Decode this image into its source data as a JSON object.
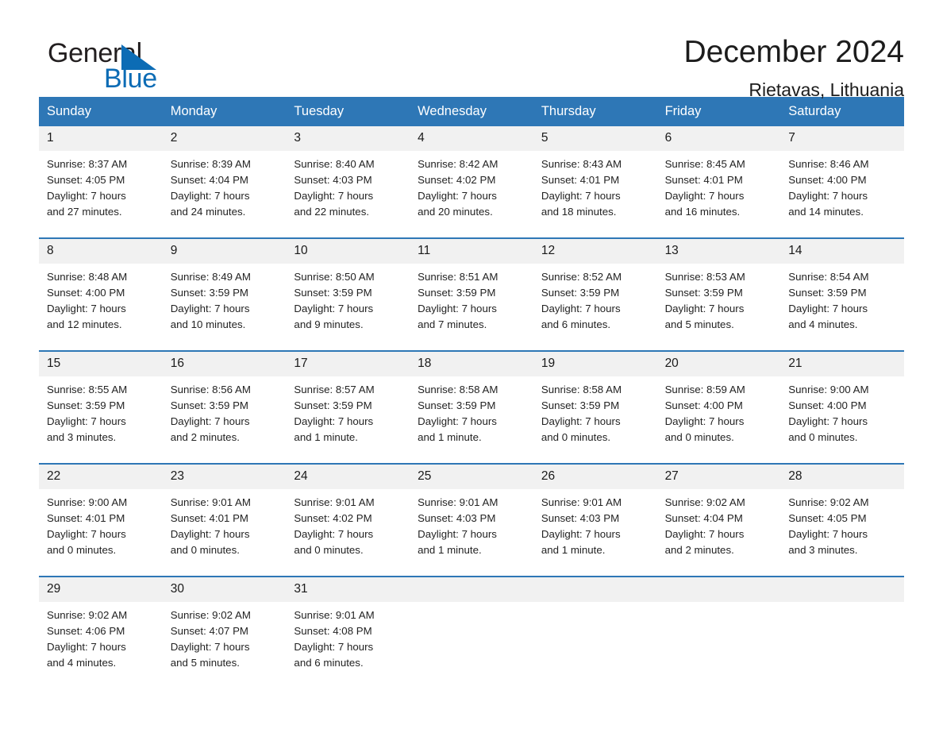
{
  "brand": {
    "name_part1": "General",
    "name_part2": "Blue",
    "mark": "triangle-logo",
    "accent_color": "#0c6cb5"
  },
  "header": {
    "title": "December 2024",
    "subtitle": "Rietavas, Lithuania"
  },
  "theme": {
    "header_bg": "#2e77b6",
    "header_text": "#ffffff",
    "daynum_bg": "#f1f1f1",
    "rule_color": "#2e77b6",
    "body_text": "#232323"
  },
  "weekdays": [
    "Sunday",
    "Monday",
    "Tuesday",
    "Wednesday",
    "Thursday",
    "Friday",
    "Saturday"
  ],
  "labels": {
    "sunrise_prefix": "Sunrise:",
    "sunset_prefix": "Sunset:",
    "daylight_prefix": "Daylight:"
  },
  "weeks": [
    [
      {
        "day": "1",
        "sunrise": "Sunrise: 8:37 AM",
        "sunset": "Sunset: 4:05 PM",
        "daylight_line1": "Daylight: 7 hours",
        "daylight_line2": "and 27 minutes."
      },
      {
        "day": "2",
        "sunrise": "Sunrise: 8:39 AM",
        "sunset": "Sunset: 4:04 PM",
        "daylight_line1": "Daylight: 7 hours",
        "daylight_line2": "and 24 minutes."
      },
      {
        "day": "3",
        "sunrise": "Sunrise: 8:40 AM",
        "sunset": "Sunset: 4:03 PM",
        "daylight_line1": "Daylight: 7 hours",
        "daylight_line2": "and 22 minutes."
      },
      {
        "day": "4",
        "sunrise": "Sunrise: 8:42 AM",
        "sunset": "Sunset: 4:02 PM",
        "daylight_line1": "Daylight: 7 hours",
        "daylight_line2": "and 20 minutes."
      },
      {
        "day": "5",
        "sunrise": "Sunrise: 8:43 AM",
        "sunset": "Sunset: 4:01 PM",
        "daylight_line1": "Daylight: 7 hours",
        "daylight_line2": "and 18 minutes."
      },
      {
        "day": "6",
        "sunrise": "Sunrise: 8:45 AM",
        "sunset": "Sunset: 4:01 PM",
        "daylight_line1": "Daylight: 7 hours",
        "daylight_line2": "and 16 minutes."
      },
      {
        "day": "7",
        "sunrise": "Sunrise: 8:46 AM",
        "sunset": "Sunset: 4:00 PM",
        "daylight_line1": "Daylight: 7 hours",
        "daylight_line2": "and 14 minutes."
      }
    ],
    [
      {
        "day": "8",
        "sunrise": "Sunrise: 8:48 AM",
        "sunset": "Sunset: 4:00 PM",
        "daylight_line1": "Daylight: 7 hours",
        "daylight_line2": "and 12 minutes."
      },
      {
        "day": "9",
        "sunrise": "Sunrise: 8:49 AM",
        "sunset": "Sunset: 3:59 PM",
        "daylight_line1": "Daylight: 7 hours",
        "daylight_line2": "and 10 minutes."
      },
      {
        "day": "10",
        "sunrise": "Sunrise: 8:50 AM",
        "sunset": "Sunset: 3:59 PM",
        "daylight_line1": "Daylight: 7 hours",
        "daylight_line2": "and 9 minutes."
      },
      {
        "day": "11",
        "sunrise": "Sunrise: 8:51 AM",
        "sunset": "Sunset: 3:59 PM",
        "daylight_line1": "Daylight: 7 hours",
        "daylight_line2": "and 7 minutes."
      },
      {
        "day": "12",
        "sunrise": "Sunrise: 8:52 AM",
        "sunset": "Sunset: 3:59 PM",
        "daylight_line1": "Daylight: 7 hours",
        "daylight_line2": "and 6 minutes."
      },
      {
        "day": "13",
        "sunrise": "Sunrise: 8:53 AM",
        "sunset": "Sunset: 3:59 PM",
        "daylight_line1": "Daylight: 7 hours",
        "daylight_line2": "and 5 minutes."
      },
      {
        "day": "14",
        "sunrise": "Sunrise: 8:54 AM",
        "sunset": "Sunset: 3:59 PM",
        "daylight_line1": "Daylight: 7 hours",
        "daylight_line2": "and 4 minutes."
      }
    ],
    [
      {
        "day": "15",
        "sunrise": "Sunrise: 8:55 AM",
        "sunset": "Sunset: 3:59 PM",
        "daylight_line1": "Daylight: 7 hours",
        "daylight_line2": "and 3 minutes."
      },
      {
        "day": "16",
        "sunrise": "Sunrise: 8:56 AM",
        "sunset": "Sunset: 3:59 PM",
        "daylight_line1": "Daylight: 7 hours",
        "daylight_line2": "and 2 minutes."
      },
      {
        "day": "17",
        "sunrise": "Sunrise: 8:57 AM",
        "sunset": "Sunset: 3:59 PM",
        "daylight_line1": "Daylight: 7 hours",
        "daylight_line2": "and 1 minute."
      },
      {
        "day": "18",
        "sunrise": "Sunrise: 8:58 AM",
        "sunset": "Sunset: 3:59 PM",
        "daylight_line1": "Daylight: 7 hours",
        "daylight_line2": "and 1 minute."
      },
      {
        "day": "19",
        "sunrise": "Sunrise: 8:58 AM",
        "sunset": "Sunset: 3:59 PM",
        "daylight_line1": "Daylight: 7 hours",
        "daylight_line2": "and 0 minutes."
      },
      {
        "day": "20",
        "sunrise": "Sunrise: 8:59 AM",
        "sunset": "Sunset: 4:00 PM",
        "daylight_line1": "Daylight: 7 hours",
        "daylight_line2": "and 0 minutes."
      },
      {
        "day": "21",
        "sunrise": "Sunrise: 9:00 AM",
        "sunset": "Sunset: 4:00 PM",
        "daylight_line1": "Daylight: 7 hours",
        "daylight_line2": "and 0 minutes."
      }
    ],
    [
      {
        "day": "22",
        "sunrise": "Sunrise: 9:00 AM",
        "sunset": "Sunset: 4:01 PM",
        "daylight_line1": "Daylight: 7 hours",
        "daylight_line2": "and 0 minutes."
      },
      {
        "day": "23",
        "sunrise": "Sunrise: 9:01 AM",
        "sunset": "Sunset: 4:01 PM",
        "daylight_line1": "Daylight: 7 hours",
        "daylight_line2": "and 0 minutes."
      },
      {
        "day": "24",
        "sunrise": "Sunrise: 9:01 AM",
        "sunset": "Sunset: 4:02 PM",
        "daylight_line1": "Daylight: 7 hours",
        "daylight_line2": "and 0 minutes."
      },
      {
        "day": "25",
        "sunrise": "Sunrise: 9:01 AM",
        "sunset": "Sunset: 4:03 PM",
        "daylight_line1": "Daylight: 7 hours",
        "daylight_line2": "and 1 minute."
      },
      {
        "day": "26",
        "sunrise": "Sunrise: 9:01 AM",
        "sunset": "Sunset: 4:03 PM",
        "daylight_line1": "Daylight: 7 hours",
        "daylight_line2": "and 1 minute."
      },
      {
        "day": "27",
        "sunrise": "Sunrise: 9:02 AM",
        "sunset": "Sunset: 4:04 PM",
        "daylight_line1": "Daylight: 7 hours",
        "daylight_line2": "and 2 minutes."
      },
      {
        "day": "28",
        "sunrise": "Sunrise: 9:02 AM",
        "sunset": "Sunset: 4:05 PM",
        "daylight_line1": "Daylight: 7 hours",
        "daylight_line2": "and 3 minutes."
      }
    ],
    [
      {
        "day": "29",
        "sunrise": "Sunrise: 9:02 AM",
        "sunset": "Sunset: 4:06 PM",
        "daylight_line1": "Daylight: 7 hours",
        "daylight_line2": "and 4 minutes."
      },
      {
        "day": "30",
        "sunrise": "Sunrise: 9:02 AM",
        "sunset": "Sunset: 4:07 PM",
        "daylight_line1": "Daylight: 7 hours",
        "daylight_line2": "and 5 minutes."
      },
      {
        "day": "31",
        "sunrise": "Sunrise: 9:01 AM",
        "sunset": "Sunset: 4:08 PM",
        "daylight_line1": "Daylight: 7 hours",
        "daylight_line2": "and 6 minutes."
      },
      {
        "day": "",
        "sunrise": "",
        "sunset": "",
        "daylight_line1": "",
        "daylight_line2": ""
      },
      {
        "day": "",
        "sunrise": "",
        "sunset": "",
        "daylight_line1": "",
        "daylight_line2": ""
      },
      {
        "day": "",
        "sunrise": "",
        "sunset": "",
        "daylight_line1": "",
        "daylight_line2": ""
      },
      {
        "day": "",
        "sunrise": "",
        "sunset": "",
        "daylight_line1": "",
        "daylight_line2": ""
      }
    ]
  ]
}
